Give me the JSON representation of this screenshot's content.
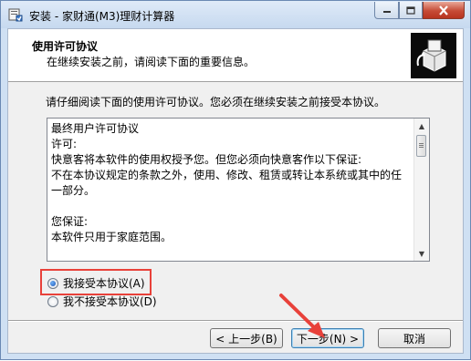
{
  "window": {
    "title": "安装 - 家财通(M3)理财计算器",
    "colors": {
      "close_button": "#c64b36",
      "annotation": "#e8413a"
    }
  },
  "header": {
    "title": "使用许可协议",
    "subtitle": "在继续安装之前，请阅读下面的重要信息。"
  },
  "instruction": "请仔细阅读下面的使用许可协议。您必须在继续安装之前接受本协议。",
  "license_text": "最终用户许可协议\n许可:\n快意客将本软件的使用权授予您。但您必须向快意客作以下保证:\n不在本协议规定的条款之外，使用、修改、租赁或转让本系统或其中的任\n一部分。\n\n您保证:\n本软件只用于家庭范围。\n\n您保证不:",
  "options": {
    "accept": {
      "label": "我接受本协议(A)",
      "selected": true
    },
    "decline": {
      "label": "我不接受本协议(D)",
      "selected": false
    }
  },
  "buttons": {
    "back": "< 上一步(B)",
    "next": "下一步(N) >",
    "cancel": "取消"
  }
}
